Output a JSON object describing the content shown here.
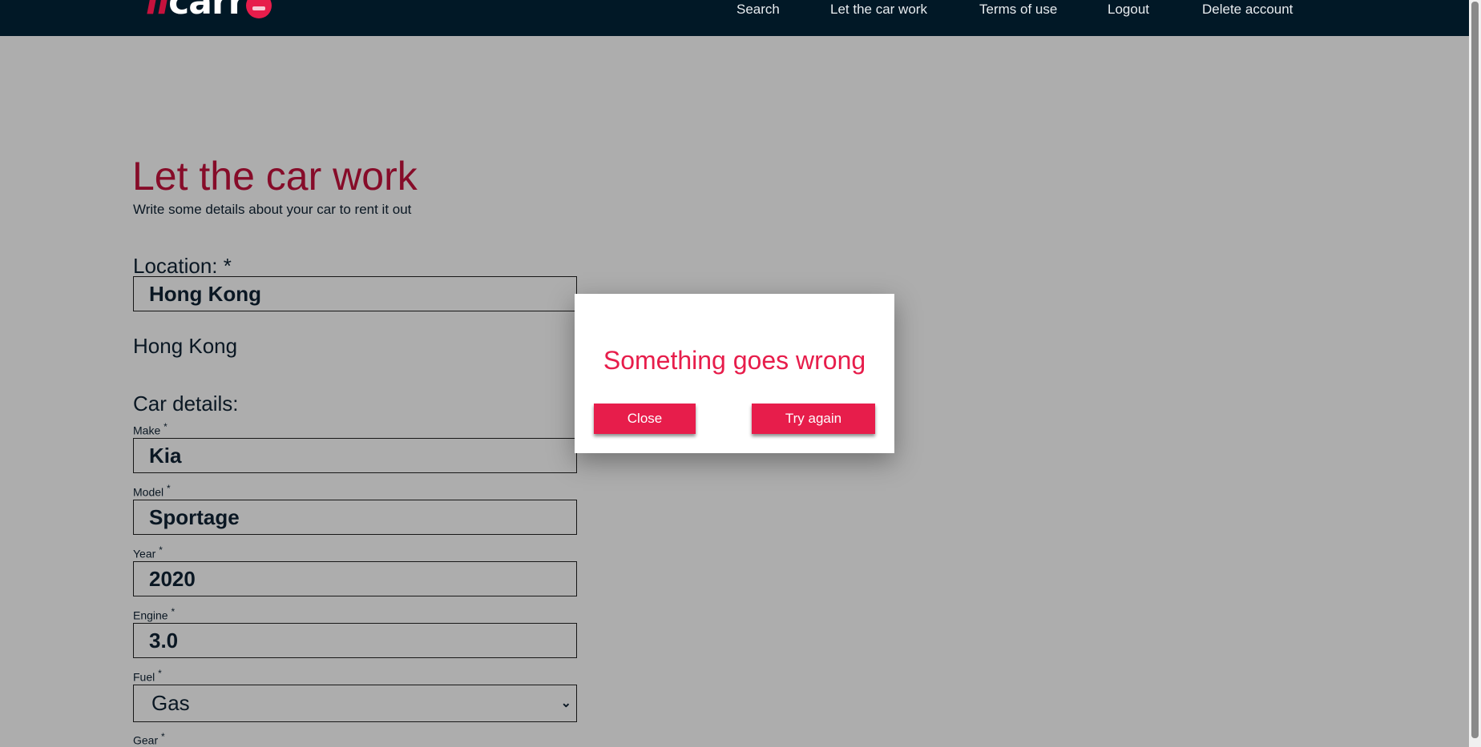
{
  "header": {
    "logo_prefix": "il",
    "logo_text": "carr",
    "nav": [
      "Search",
      "Let the car work",
      "Terms of use",
      "Logout",
      "Delete account"
    ]
  },
  "page": {
    "title": "Let the car work",
    "subtitle": "Write some details about your car to rent it out",
    "location_label": "Location: *",
    "location_value": "Hong Kong",
    "location_result": "Hong Kong",
    "car_details_label": "Car details:",
    "fields": {
      "make": {
        "label": "Make",
        "required": "*",
        "value": "Kia"
      },
      "model": {
        "label": "Model",
        "required": "*",
        "value": "Sportage"
      },
      "year": {
        "label": "Year",
        "required": "*",
        "value": "2020"
      },
      "engine": {
        "label": "Engine",
        "required": "*",
        "value": "3.0"
      },
      "fuel": {
        "label": "Fuel",
        "required": "*",
        "value": "Gas"
      },
      "gear": {
        "label": "Gear",
        "required": "*"
      }
    }
  },
  "dialog": {
    "title": "Something goes wrong",
    "close_label": "Close",
    "try_again_label": "Try again"
  },
  "colors": {
    "brand_red": "#e71d4b",
    "title_red": "#c6123d",
    "header_bg": "#011826"
  },
  "icons": {
    "select_arrow": "chevron-down-icon",
    "logo_car": "car-icon"
  }
}
